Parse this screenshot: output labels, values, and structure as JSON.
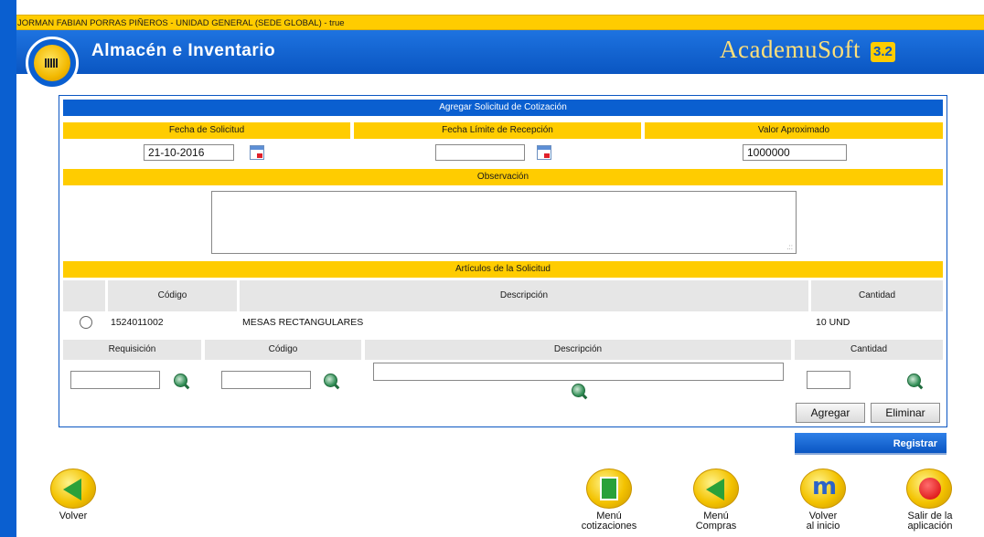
{
  "user_bar": {
    "text": "JORMAN FABIAN PORRAS PIÑEROS - UNIDAD GENERAL (SEDE GLOBAL) - true"
  },
  "header": {
    "title": "Almacén e Inventario",
    "brand": "AcademuSoft",
    "brand_version": "3.2"
  },
  "form": {
    "title": "Agregar Solicitud de Cotización",
    "fecha_solicitud_label": "Fecha de Solicitud",
    "fecha_solicitud_value": "21-10-2016",
    "fecha_limite_label": "Fecha Límite de Recepción",
    "fecha_limite_value": "",
    "valor_label": "Valor Aproximado",
    "valor_value": "1000000",
    "observacion_label": "Observación",
    "observacion_value": ""
  },
  "articulos": {
    "title": "Artículos de la Solicitud",
    "headers": {
      "codigo": "Código",
      "descripcion": "Descripción",
      "cantidad": "Cantidad"
    },
    "rows": [
      {
        "codigo": "1524011002",
        "descripcion": "MESAS RECTANGULARES",
        "cantidad": "10 UND"
      }
    ]
  },
  "add_row": {
    "headers": {
      "requisicion": "Requisición",
      "codigo": "Código",
      "descripcion": "Descripción",
      "cantidad": "Cantidad"
    }
  },
  "buttons": {
    "agregar": "Agregar",
    "eliminar": "Eliminar",
    "registrar": "Registrar"
  },
  "nav": {
    "volver": "Volver",
    "menu_cot_1": "Menú",
    "menu_cot_2": "cotizaciones",
    "menu_compras_1": "Menú",
    "menu_compras_2": "Compras",
    "volver_inicio_1": "Volver",
    "volver_inicio_2": "al inicio",
    "salir_1": "Salir de la",
    "salir_2": "aplicación"
  },
  "icons": [
    "calendar-icon",
    "search-icon",
    "back-arrow-icon",
    "quotes-menu-icon",
    "purchases-menu-icon",
    "home-icon",
    "exit-icon"
  ],
  "colors": {
    "primary_blue": "#0a5fd0",
    "yellow": "#ffcc00",
    "header_gray": "#e6e6e6"
  }
}
